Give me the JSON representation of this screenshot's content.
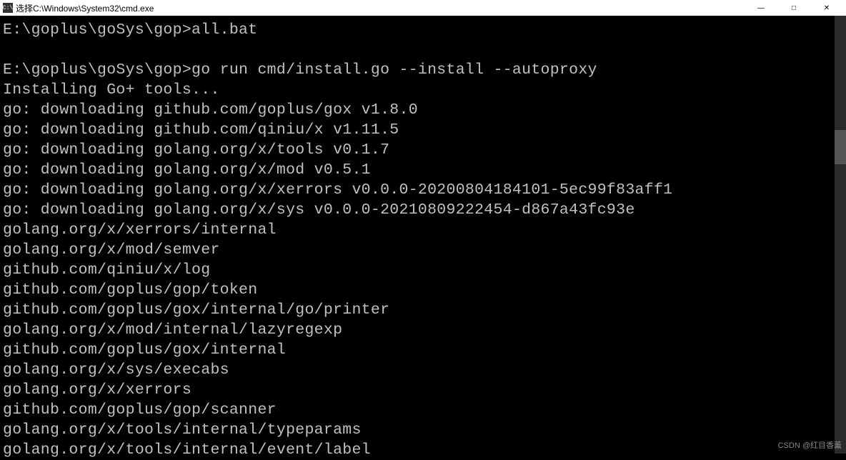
{
  "titlebar": {
    "icon_label": "C:\\",
    "title": "选择C:\\Windows\\System32\\cmd.exe",
    "minimize": "—",
    "maximize": "□",
    "close": "✕"
  },
  "terminal": {
    "lines": [
      "E:\\goplus\\goSys\\gop>all.bat",
      "",
      "E:\\goplus\\goSys\\gop>go run cmd/install.go --install --autoproxy",
      "Installing Go+ tools...",
      "go: downloading github.com/goplus/gox v1.8.0",
      "go: downloading github.com/qiniu/x v1.11.5",
      "go: downloading golang.org/x/tools v0.1.7",
      "go: downloading golang.org/x/mod v0.5.1",
      "go: downloading golang.org/x/xerrors v0.0.0-20200804184101-5ec99f83aff1",
      "go: downloading golang.org/x/sys v0.0.0-20210809222454-d867a43fc93e",
      "golang.org/x/xerrors/internal",
      "golang.org/x/mod/semver",
      "github.com/qiniu/x/log",
      "github.com/goplus/gop/token",
      "github.com/goplus/gox/internal/go/printer",
      "golang.org/x/mod/internal/lazyregexp",
      "github.com/goplus/gox/internal",
      "golang.org/x/sys/execabs",
      "golang.org/x/xerrors",
      "github.com/goplus/gop/scanner",
      "golang.org/x/tools/internal/typeparams",
      "golang.org/x/tools/internal/event/label"
    ]
  },
  "watermark": "CSDN @红目香薰"
}
